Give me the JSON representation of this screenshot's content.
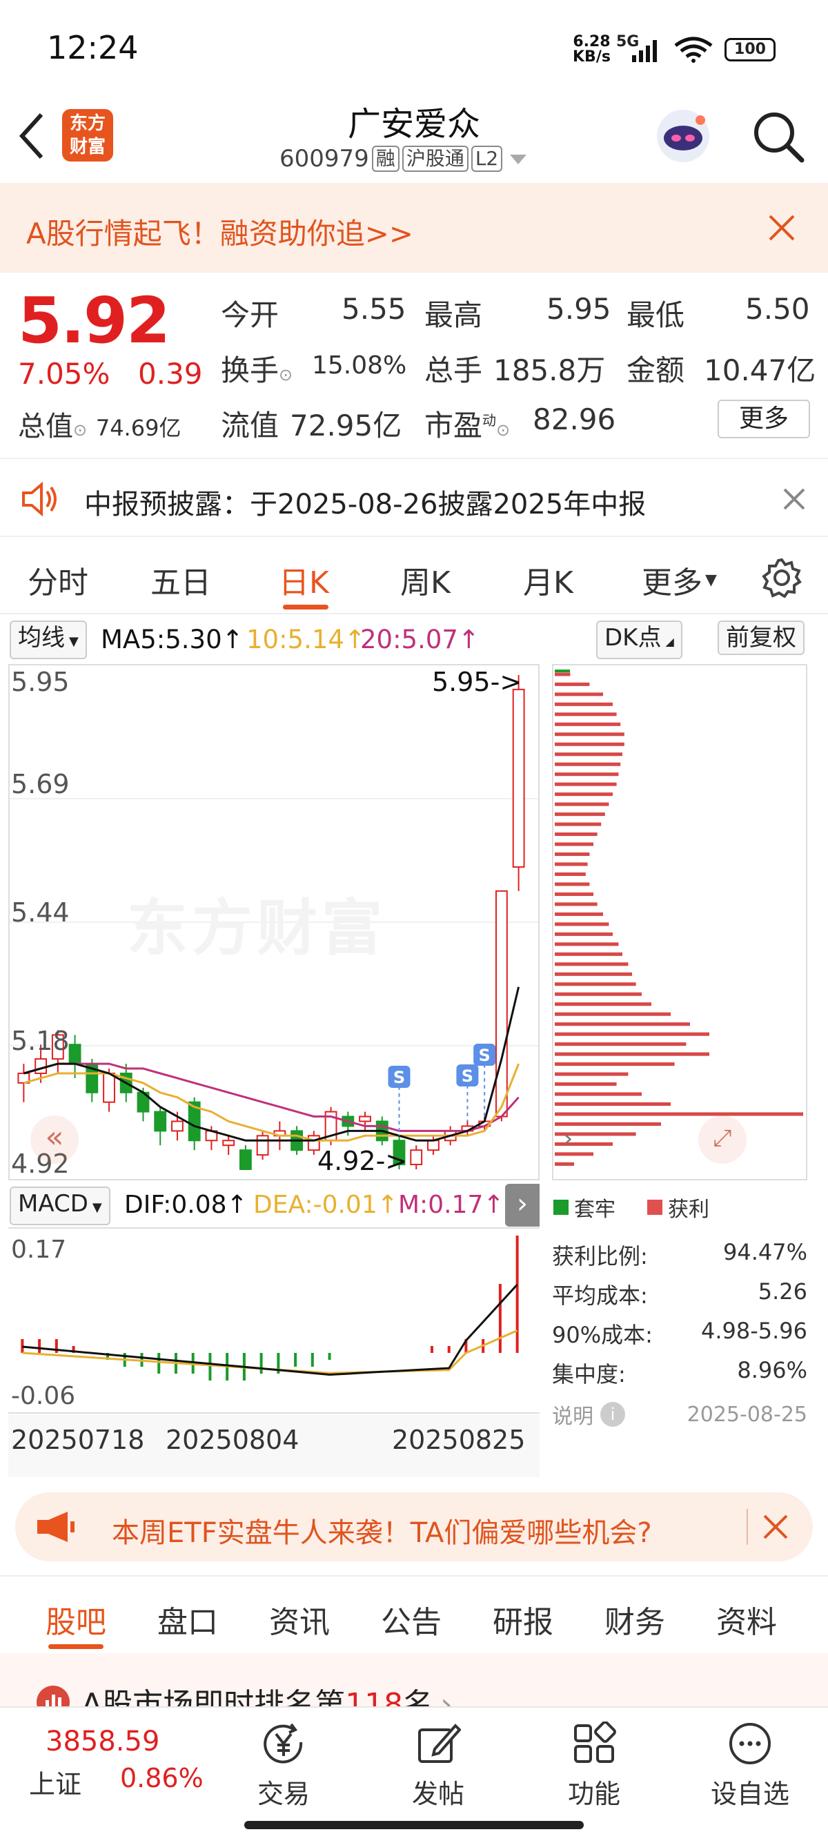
{
  "status": {
    "time": "12:24",
    "speed_value": "6.28",
    "speed_unit": "KB/s",
    "network": "5G",
    "battery": "100"
  },
  "header": {
    "title": "广安爱众",
    "code": "600979",
    "tags": [
      "融",
      "沪股通",
      "L2"
    ],
    "logo_line1": "东方",
    "logo_line2": "财富"
  },
  "banner": {
    "text": "A股行情起飞！融资助你追>>"
  },
  "quote": {
    "price": "5.92",
    "change_pct": "7.05%",
    "change": "0.39",
    "open_label": "今开",
    "open": "5.55",
    "high_label": "最高",
    "high": "5.95",
    "low_label": "最低",
    "low": "5.50",
    "turnover_label": "换手",
    "turnover": "15.08%",
    "volume_label": "总手",
    "volume": "185.8万",
    "amount_label": "金额",
    "amount": "10.47亿",
    "mktcap_label": "总值",
    "mktcap": "74.69亿",
    "float_label": "流值",
    "float": "72.95亿",
    "pe_label": "市盈",
    "pe_sup": "动",
    "pe": "82.96",
    "more": "更多"
  },
  "notice": {
    "text": "中报预披露：于2025-08-26披露2025年中报"
  },
  "chart_tabs": [
    "分时",
    "五日",
    "日K",
    "周K",
    "月K",
    "更多"
  ],
  "active_tab": "日K",
  "ma": {
    "selector": "均线",
    "ma5": "MA5:5.30↑",
    "ma10": "10:5.14↑",
    "ma20": "20:5.07↑",
    "dk": "DK点",
    "fq": "前复权"
  },
  "colors": {
    "up": "#e02020",
    "down": "#1a9b2a",
    "ma5": "#111111",
    "ma10": "#e8b030",
    "ma20": "#c0307a",
    "accent": "#e8541e"
  },
  "price_axis": {
    "labels": [
      "5.95",
      "5.69",
      "5.44",
      "5.18",
      "4.92"
    ],
    "max_marker": "5.95->",
    "min_marker": "4.92->"
  },
  "watermark": "东方财富",
  "chart_data": {
    "type": "candlestick",
    "x": [
      "20250718",
      "20250804",
      "20250825"
    ],
    "ylim": [
      4.92,
      5.95
    ],
    "candles": [
      [
        5.1,
        5.12,
        5.14,
        5.06
      ],
      [
        5.12,
        5.15,
        5.18,
        5.1
      ],
      [
        5.15,
        5.2,
        5.21,
        5.12
      ],
      [
        5.18,
        5.14,
        5.2,
        5.11
      ],
      [
        5.14,
        5.08,
        5.15,
        5.06
      ],
      [
        5.06,
        5.12,
        5.13,
        5.04
      ],
      [
        5.12,
        5.08,
        5.14,
        5.06
      ],
      [
        5.08,
        5.04,
        5.09,
        5.02
      ],
      [
        5.04,
        5.0,
        5.05,
        4.97
      ],
      [
        5.0,
        5.02,
        5.04,
        4.98
      ],
      [
        5.06,
        4.98,
        5.07,
        4.96
      ],
      [
        4.98,
        5.0,
        5.01,
        4.96
      ],
      [
        4.97,
        4.98,
        4.99,
        4.95
      ],
      [
        4.96,
        4.92,
        4.97,
        4.92
      ],
      [
        4.95,
        4.99,
        5.0,
        4.94
      ],
      [
        4.99,
        5.0,
        5.02,
        4.96
      ],
      [
        5.0,
        4.96,
        5.01,
        4.95
      ],
      [
        4.96,
        4.99,
        5.0,
        4.95
      ],
      [
        4.98,
        5.04,
        5.05,
        4.97
      ],
      [
        5.03,
        5.01,
        5.04,
        4.99
      ],
      [
        5.02,
        5.03,
        5.04,
        5.0
      ],
      [
        5.02,
        4.98,
        5.03,
        4.97
      ],
      [
        4.98,
        4.93,
        4.99,
        4.92
      ],
      [
        4.93,
        4.96,
        4.97,
        4.92
      ],
      [
        4.96,
        4.98,
        4.99,
        4.95
      ],
      [
        4.98,
        5.0,
        5.01,
        4.97
      ],
      [
        5.0,
        5.01,
        5.02,
        4.99
      ],
      [
        5.01,
        5.02,
        5.03,
        5.0
      ],
      [
        5.03,
        5.5,
        5.5,
        5.02
      ],
      [
        5.55,
        5.92,
        5.95,
        5.5
      ]
    ],
    "ma5": [
      5.12,
      5.13,
      5.14,
      5.14,
      5.13,
      5.12,
      5.1,
      5.08,
      5.05,
      5.03,
      5.01,
      5.0,
      4.99,
      4.98,
      4.98,
      4.98,
      4.98,
      4.98,
      4.99,
      5.0,
      5.0,
      5.0,
      4.99,
      4.98,
      4.98,
      4.99,
      5.0,
      5.02,
      5.15,
      5.3
    ],
    "ma10": [
      5.1,
      5.11,
      5.12,
      5.12,
      5.12,
      5.12,
      5.11,
      5.1,
      5.08,
      5.07,
      5.05,
      5.04,
      5.02,
      5.01,
      5.0,
      4.99,
      4.99,
      4.98,
      4.98,
      4.98,
      4.99,
      4.99,
      4.99,
      4.99,
      4.99,
      4.99,
      4.99,
      5.0,
      5.05,
      5.14
    ],
    "ma20": [
      5.12,
      5.13,
      5.14,
      5.14,
      5.14,
      5.14,
      5.13,
      5.13,
      5.12,
      5.11,
      5.1,
      5.09,
      5.08,
      5.07,
      5.06,
      5.05,
      5.04,
      5.03,
      5.03,
      5.02,
      5.01,
      5.01,
      5.0,
      5.0,
      5.0,
      5.0,
      5.0,
      5.01,
      5.03,
      5.07
    ]
  },
  "macd": {
    "selector": "MACD",
    "dif": "DIF:0.08↑",
    "dea": "DEA:-0.01↑",
    "m": "M:0.17↑",
    "axis_top": "0.17",
    "axis_bottom": "-0.06"
  },
  "macd_bars": [
    0.02,
    0.02,
    0.02,
    0.01,
    0.0,
    -0.01,
    -0.02,
    -0.02,
    -0.03,
    -0.03,
    -0.03,
    -0.04,
    -0.04,
    -0.04,
    -0.03,
    -0.03,
    -0.02,
    -0.02,
    -0.01,
    0.0,
    0.0,
    0.0,
    0.0,
    0.0,
    0.01,
    0.01,
    0.02,
    0.02,
    0.1,
    0.17
  ],
  "dates": [
    "20250718",
    "20250804",
    "20250825"
  ],
  "distribution": {
    "legend_trap": "套牢",
    "legend_profit": "获利",
    "profit_ratio_label": "获利比例:",
    "profit_ratio": "94.47%",
    "avg_cost_label": "平均成本:",
    "avg_cost": "5.26",
    "cost90_label": "90%成本:",
    "cost90": "4.98-5.96",
    "concentration_label": "集中度:",
    "concentration": "8.96%",
    "explain_label": "说明",
    "date": "2025-08-25",
    "bars": [
      0.08,
      0.18,
      0.25,
      0.3,
      0.32,
      0.34,
      0.36,
      0.36,
      0.35,
      0.34,
      0.33,
      0.32,
      0.3,
      0.28,
      0.26,
      0.24,
      0.22,
      0.2,
      0.18,
      0.17,
      0.16,
      0.18,
      0.2,
      0.22,
      0.25,
      0.28,
      0.3,
      0.33,
      0.35,
      0.38,
      0.4,
      0.42,
      0.45,
      0.5,
      0.6,
      0.7,
      0.8,
      0.68,
      0.8,
      0.62,
      0.38,
      0.32,
      0.45,
      0.6,
      0.95,
      0.55,
      0.42,
      0.3,
      0.2,
      0.1
    ]
  },
  "etf_banner": {
    "text": "本周ETF实盘牛人来袭！TA们偏爱哪些机会?"
  },
  "bottom_tabs": [
    "股吧",
    "盘口",
    "资讯",
    "公告",
    "研报",
    "财务",
    "资料"
  ],
  "active_bottom_tab": "股吧",
  "rank_text": {
    "prefix": "A股市场即时排名第",
    "num": "118",
    "suffix": "名"
  },
  "bottom_bar": {
    "index_value": "3858.59",
    "index_name": "上证",
    "index_change": "0.86%",
    "items": [
      "交易",
      "发帖",
      "功能",
      "设自选"
    ]
  }
}
